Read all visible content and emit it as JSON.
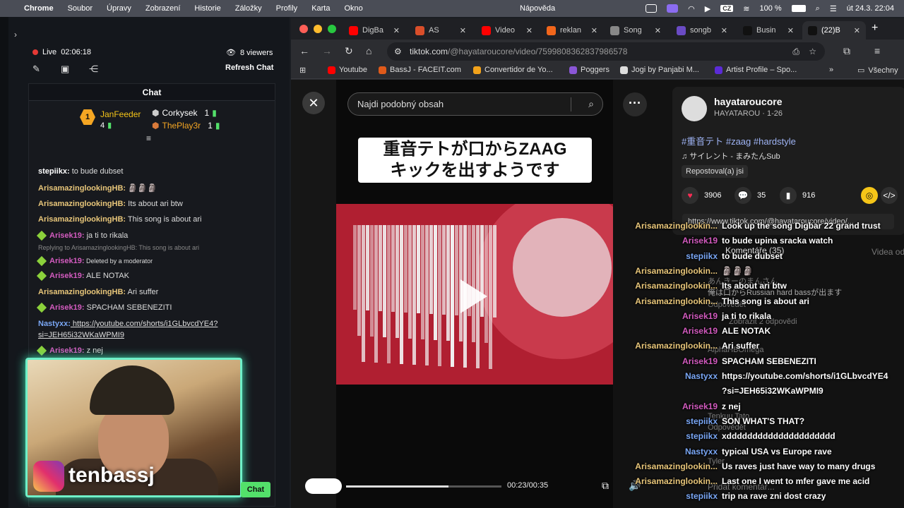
{
  "menubar": {
    "app": "Chrome",
    "items": [
      "Soubor",
      "Úpravy",
      "Zobrazení",
      "Historie",
      "Záložky",
      "Profily",
      "Karta",
      "Okno"
    ],
    "help": "Nápověda",
    "battery": "100 %",
    "lang": "CZ",
    "clock": "út 24.3.  22:04"
  },
  "stream": {
    "live_label": "Live",
    "live_time": "02:06:18",
    "viewers": "8 viewers",
    "refresh": "Refresh Chat",
    "chat_title": "Chat",
    "leaderboard": [
      {
        "name": "JanFeeder",
        "count": "4"
      },
      {
        "name": "Corkysek",
        "count": "1"
      },
      {
        "name": "ThePlay3r",
        "count": "1"
      }
    ],
    "rank": "1",
    "messages": [
      {
        "user": "stepiikx:",
        "text": " to bude dubset",
        "cls": "c-step",
        "diamond": false
      },
      {
        "user": "ArisamazinglookingHB:",
        "text": " 🗿🗿🗿",
        "cls": "c-ari",
        "diamond": false
      },
      {
        "user": "ArisamazinglookingHB:",
        "text": " Its about ari btw",
        "cls": "c-ari",
        "diamond": false
      },
      {
        "user": "ArisamazinglookingHB:",
        "text": " This song is about ari",
        "cls": "c-ari",
        "diamond": false
      },
      {
        "user": "Arisek19:",
        "text": " ja ti to rikala",
        "cls": "c-arisek",
        "diamond": true
      },
      {
        "user": "Arisek19:",
        "text": " Deleted by a moderator",
        "cls": "c-arisek",
        "diamond": true
      },
      {
        "user": "Arisek19:",
        "text": " ALE NOTAK",
        "cls": "c-arisek",
        "diamond": true
      },
      {
        "user": "ArisamazinglookingHB:",
        "text": " Ari suffer",
        "cls": "c-ari",
        "diamond": false
      },
      {
        "user": "Arisek19:",
        "text": " SPACHAM SEBENEZITI",
        "cls": "c-arisek",
        "diamond": true
      },
      {
        "user": "Nastyxx:",
        "text": " https://youtube.com/shorts/i1GLbvcdYE4?",
        "cls": "c-nas",
        "diamond": false
      },
      {
        "user": "",
        "text": "si=JEH65i32WKaWPMI9",
        "cls": "c-nas",
        "diamond": false
      },
      {
        "user": "Arisek19:",
        "text": " z nej",
        "cls": "c-arisek",
        "diamond": true
      }
    ],
    "reply_note": "Replying to ArisamazinglookingHB: This song is about ari",
    "webcam_brand": "tenbassj",
    "chat_button": "Chat"
  },
  "browser": {
    "tabs": [
      {
        "label": "DigBa",
        "color": "#ff0000"
      },
      {
        "label": "AS",
        "color": "#d94e2a"
      },
      {
        "label": "Video",
        "color": "#ff0000"
      },
      {
        "label": "reklan",
        "color": "#f2661b"
      },
      {
        "label": "Song",
        "color": "#888888"
      },
      {
        "label": "songb",
        "color": "#6a4bc4"
      },
      {
        "label": "Busin",
        "color": "#111111"
      },
      {
        "label": "(22)B",
        "color": "#111111"
      }
    ],
    "url_host": "tiktok.com",
    "url_path": "/@hayataroucore/video/7599808362837986578",
    "bookmarks": [
      "Youtube",
      "BassJ - FACEIT.com",
      "Convertidor de Yo...",
      "Poggers",
      "Jogi by Panjabi M...",
      "Artist Profile – Spo..."
    ],
    "bookmarks_all": "Všechny"
  },
  "tiktok": {
    "search_placeholder": "Najdi podobný obsah",
    "caption": "重音テトが口からZAAG\nキックを出すようです",
    "time": "00:23/00:35",
    "progress": 0.66,
    "username": "hayataroucore",
    "subline": "HAYATAROU · 1-26",
    "tags": "#重音テト #zaag #hardstyle",
    "sound": "♫  サイレント - まみたんSub",
    "repost": "Repostoval(a) jsi",
    "likes": "3906",
    "comments_count": "35",
    "saves": "916",
    "share_url": "https://www.tiktok.com/@hayataroucore/video/...",
    "comments_header": "Komentáře (35)",
    "videos_tab": "Videa od",
    "bg_comments": [
      "あんきーのまんさん",
      "俺は口からRussian hard bassが出ます",
      "Odpovědět",
      "Zobrazit 2 odpovědi",
      "AlphaHBOmega",
      "Tenkuu Tato",
      "Odpovědět",
      "Tyler",
      "Přidat komentář..."
    ]
  },
  "overlay_chat": [
    {
      "user": "Arisamazinglookin...",
      "text": "Look up the song Digbar 22 grand trust",
      "cls": "c-ari"
    },
    {
      "user": "Arisek19",
      "text": "to bude upina sracka watch",
      "cls": "c-arisek"
    },
    {
      "user": "stepiikx",
      "text": "to bude dubset",
      "cls": "c-nas"
    },
    {
      "user": "Arisamazinglookin...",
      "text": "🗿🗿🗿",
      "cls": "c-ari"
    },
    {
      "user": "Arisamazinglookin...",
      "text": "Its about ari btw",
      "cls": "c-ari"
    },
    {
      "user": "Arisamazinglookin...",
      "text": "This song is about ari",
      "cls": "c-ari"
    },
    {
      "user": "Arisek19",
      "text": "ja ti to rikala",
      "cls": "c-arisek"
    },
    {
      "user": "Arisek19",
      "text": "ALE NOTAK",
      "cls": "c-arisek"
    },
    {
      "user": "Arisamazinglookin...",
      "text": "Ari suffer",
      "cls": "c-ari"
    },
    {
      "user": "Arisek19",
      "text": "SPACHAM SEBENEZITI",
      "cls": "c-arisek"
    },
    {
      "user": "Nastyxx",
      "text": "https://youtube.com/shorts/i1GLbvcdYE4",
      "cls": "c-nas"
    },
    {
      "user": "",
      "text": "?si=JEH65i32WKaWPMI9",
      "cls": "c-nas"
    },
    {
      "user": "Arisek19",
      "text": "z nej",
      "cls": "c-arisek"
    },
    {
      "user": "stepiikx",
      "text": "SON WHAT'S THAT?",
      "cls": "c-nas"
    },
    {
      "user": "stepiikx",
      "text": "xddddddddddddddddddddd",
      "cls": "c-nas"
    },
    {
      "user": "Nastyxx",
      "text": "typical USA vs Europe rave",
      "cls": "c-nas"
    },
    {
      "user": "Arisamazinglookin...",
      "text": "Us raves just have way to many drugs",
      "cls": "c-ari"
    },
    {
      "user": "Arisamazinglookin...",
      "text": "Last one I went to mfer gave me acid",
      "cls": "c-ari"
    },
    {
      "user": "stepiikx",
      "text": "trip na rave zni dost crazy",
      "cls": "c-nas"
    }
  ]
}
